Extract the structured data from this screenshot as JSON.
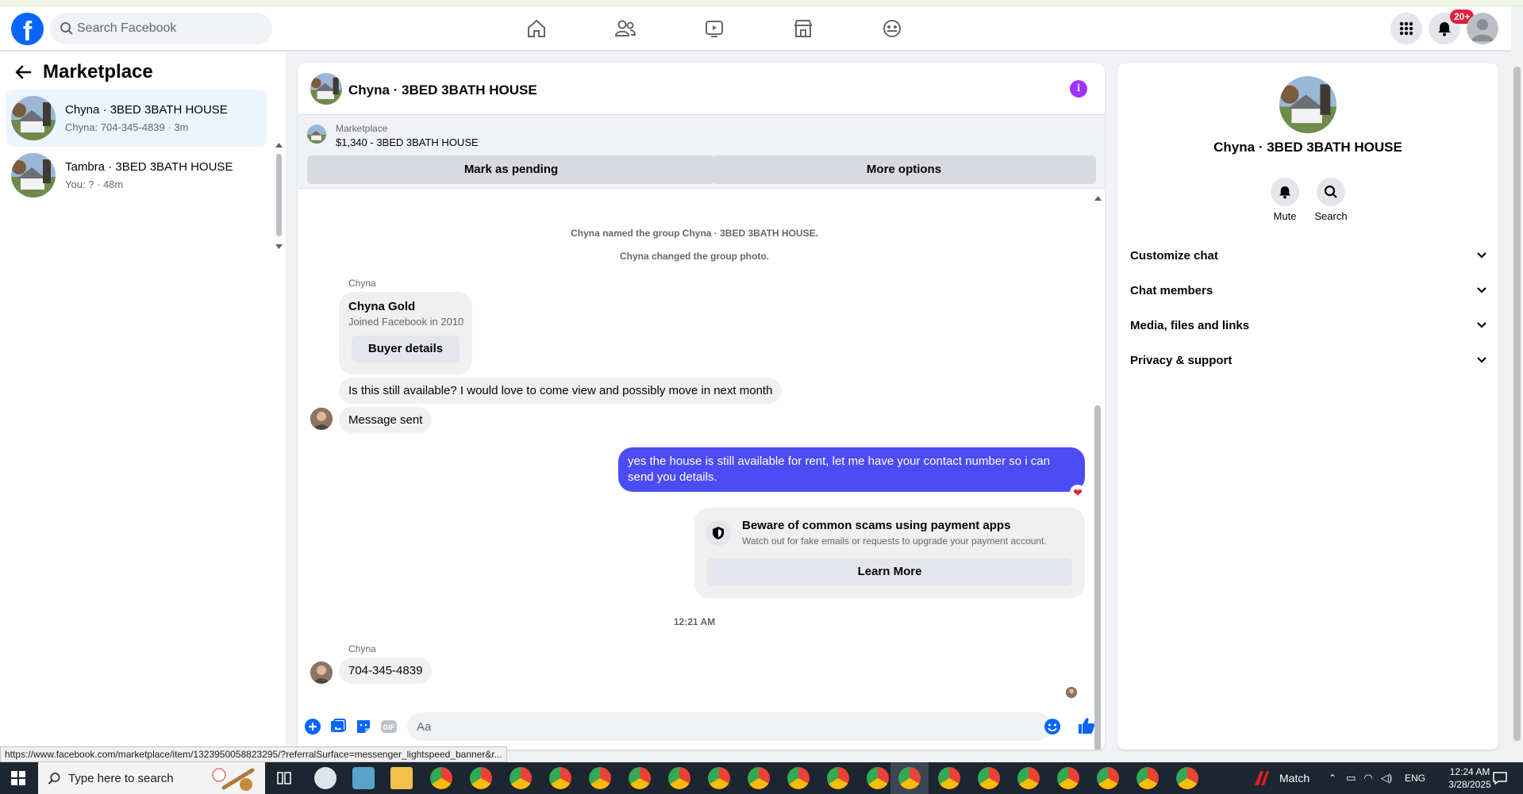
{
  "topbar": {
    "search_placeholder": "Search Facebook",
    "notification_badge": "20+"
  },
  "left": {
    "title": "Marketplace",
    "conversations": [
      {
        "name": "Chyna · 3BED 3BATH HOUSE",
        "preview": "Chyna: 704-345-4839 · 3m"
      },
      {
        "name": "Tambra · 3BED 3BATH HOUSE",
        "preview": "You: ? · 48m"
      }
    ]
  },
  "chat": {
    "title": "Chyna · 3BED 3BATH HOUSE",
    "listing": {
      "label": "Marketplace",
      "price_title": "$1,340 - 3BED 3BATH HOUSE",
      "mark_pending": "Mark as pending",
      "more_options": "More options"
    },
    "system_messages": [
      "Chyna named the group Chyna · 3BED 3BATH HOUSE.",
      "Chyna changed the group photo."
    ],
    "sender_name": "Chyna",
    "buyer_card": {
      "name": "Chyna Gold",
      "joined": "Joined Facebook in 2010",
      "button": "Buyer details"
    },
    "messages": {
      "in_1": "Is this still available? I would love to come view and possibly move in next month",
      "in_2": "Message sent",
      "out_1": "yes the house is still available for rent, let me have your contact number so i can send you details.",
      "in_3": "704-345-4839"
    },
    "reaction": "❤",
    "scam": {
      "title": "Beware of common scams using payment apps",
      "subtitle": "Watch out for fake emails or requests to upgrade your payment account.",
      "button": "Learn More"
    },
    "timestamp": "12:21 AM",
    "sender_name_2": "Chyna",
    "composer_placeholder": "Aa"
  },
  "right": {
    "name": "Chyna · 3BED 3BATH HOUSE",
    "actions": [
      {
        "label": "Mute"
      },
      {
        "label": "Search"
      }
    ],
    "sections": [
      "Customize chat",
      "Chat members",
      "Media, files and links",
      "Privacy & support"
    ]
  },
  "status_url": "https://www.facebook.com/marketplace/item/1323950058823295/?referralSurface=messenger_lightspeed_banner&r...",
  "taskbar": {
    "search_placeholder": "Type here to search",
    "weather_label": "Match",
    "language": "ENG",
    "time": "12:24 AM",
    "date": "3/28/2025"
  },
  "colors": {
    "facebook_blue": "#0866ff",
    "outgoing_bubble": "#4c4cf5",
    "info_purple": "#a033ff",
    "badge_red": "#e41e3f"
  }
}
